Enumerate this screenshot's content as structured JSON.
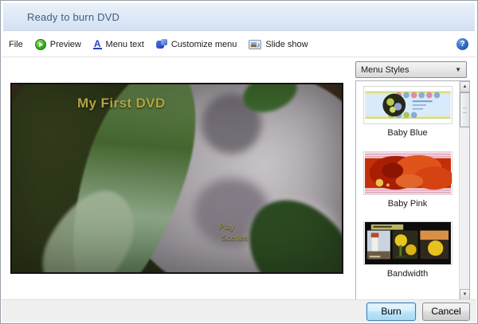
{
  "window": {
    "title": "Ready to burn DVD",
    "help_icon": "?"
  },
  "toolbar": {
    "file": "File",
    "preview": "Preview",
    "menu_text": "Menu text",
    "customize_menu": "Customize menu",
    "slide_show": "Slide show"
  },
  "preview_menu": {
    "title": "My First DVD",
    "play": "Play",
    "scenes": "Scenes"
  },
  "menu_styles": {
    "dropdown_label": "Menu Styles",
    "dropdown_arrow": "▼",
    "items": [
      {
        "name": "Baby Blue"
      },
      {
        "name": "Baby Pink"
      },
      {
        "name": "Bandwidth"
      }
    ]
  },
  "scrollbar": {
    "up_arrow": "▲",
    "down_arrow": "▼"
  },
  "footer": {
    "burn": "Burn",
    "cancel": "Cancel"
  },
  "colors": {
    "header_text": "#3c5e85",
    "dvd_menu_text": "#b3a443",
    "burn_glow": "#9adcf5",
    "preview_play_green": "#3dae27",
    "toolbar_icon_blue": "#2243c0"
  }
}
